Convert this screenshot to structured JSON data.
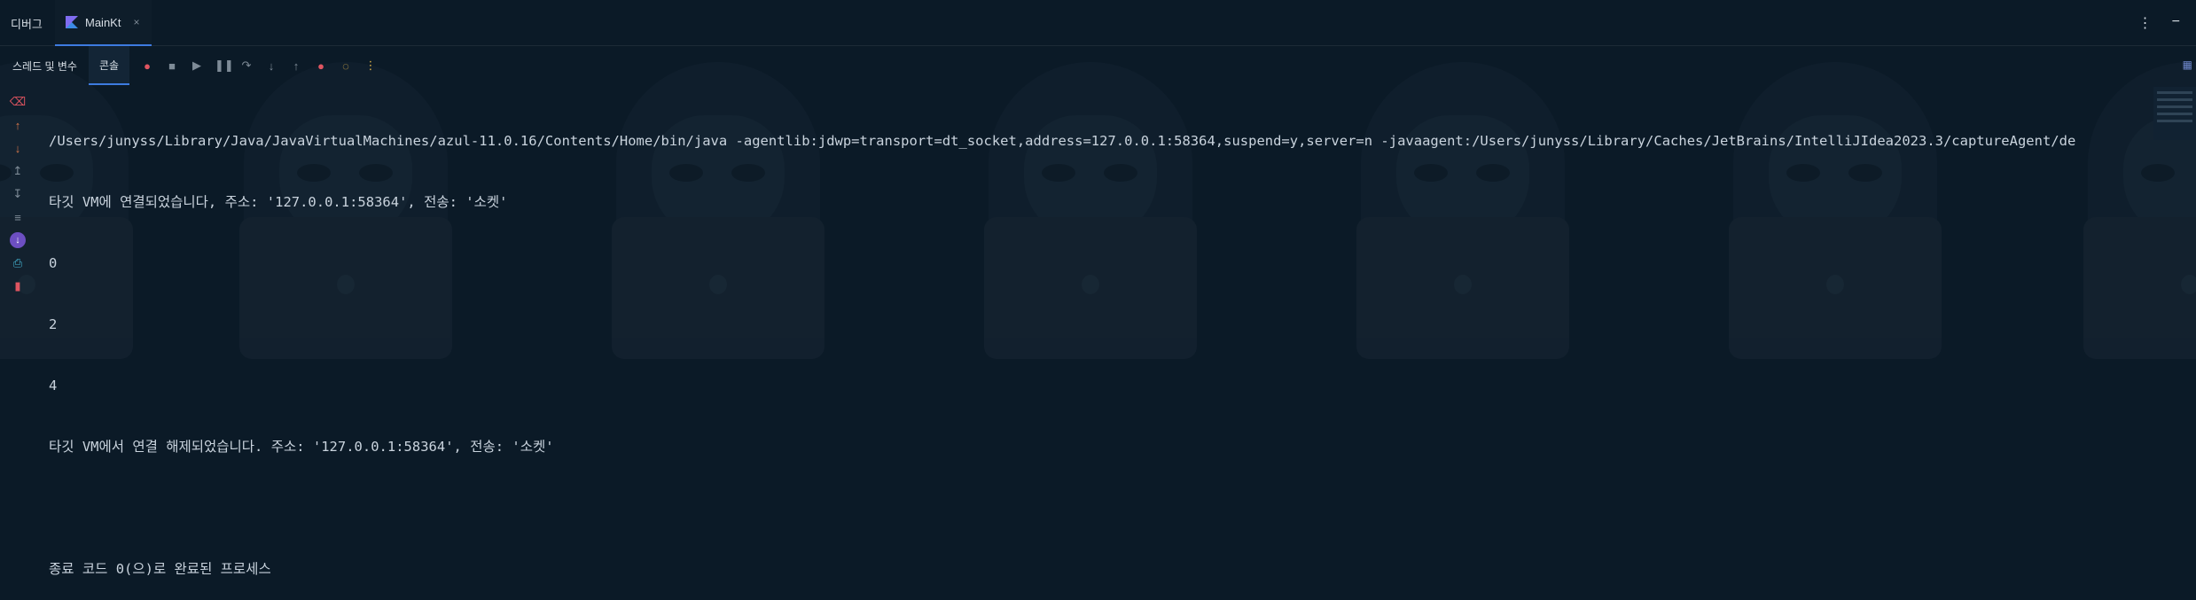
{
  "tabs": {
    "debug_label": "디버그",
    "main_label": "MainKt",
    "close_glyph": "×"
  },
  "top_right": {
    "more": "⋮",
    "minimize": "−"
  },
  "toolbar": {
    "threads_label": "스레드 및 변수",
    "console_label": "콘솔",
    "icons": [
      "restart-debug-icon",
      "stop-icon",
      "resume-icon",
      "pause-icon",
      "step-over-icon",
      "step-into-icon",
      "step-out-icon",
      "view-breakpoints-icon",
      "mute-breakpoints-icon",
      "more-icon"
    ]
  },
  "gutter": {
    "icons": [
      "clear-icon",
      "up-arrow-icon",
      "down-arrow-icon",
      "scroll-up-icon",
      "scroll-down-icon",
      "soft-wrap-icon",
      "debug-status-icon",
      "print-icon",
      "trash-icon"
    ]
  },
  "console": {
    "lines": [
      "/Users/junyss/Library/Java/JavaVirtualMachines/azul-11.0.16/Contents/Home/bin/java -agentlib:jdwp=transport=dt_socket,address=127.0.0.1:58364,suspend=y,server=n -javaagent:/Users/junyss/Library/Caches/JetBrains/IntelliJIdea2023.3/captureAgent/de",
      "타깃 VM에 연결되었습니다, 주소: '127.0.0.1:58364', 전송: '소켓'",
      "0",
      "2",
      "4",
      "타깃 VM에서 연결 해제되었습니다. 주소: '127.0.0.1:58364', 전송: '소켓'",
      "",
      "종료 코드 0(으)로 완료된 프로세스"
    ]
  },
  "colors": {
    "background": "#0b1a27",
    "accent": "#3d7be0",
    "text": "#c9d3dd"
  }
}
